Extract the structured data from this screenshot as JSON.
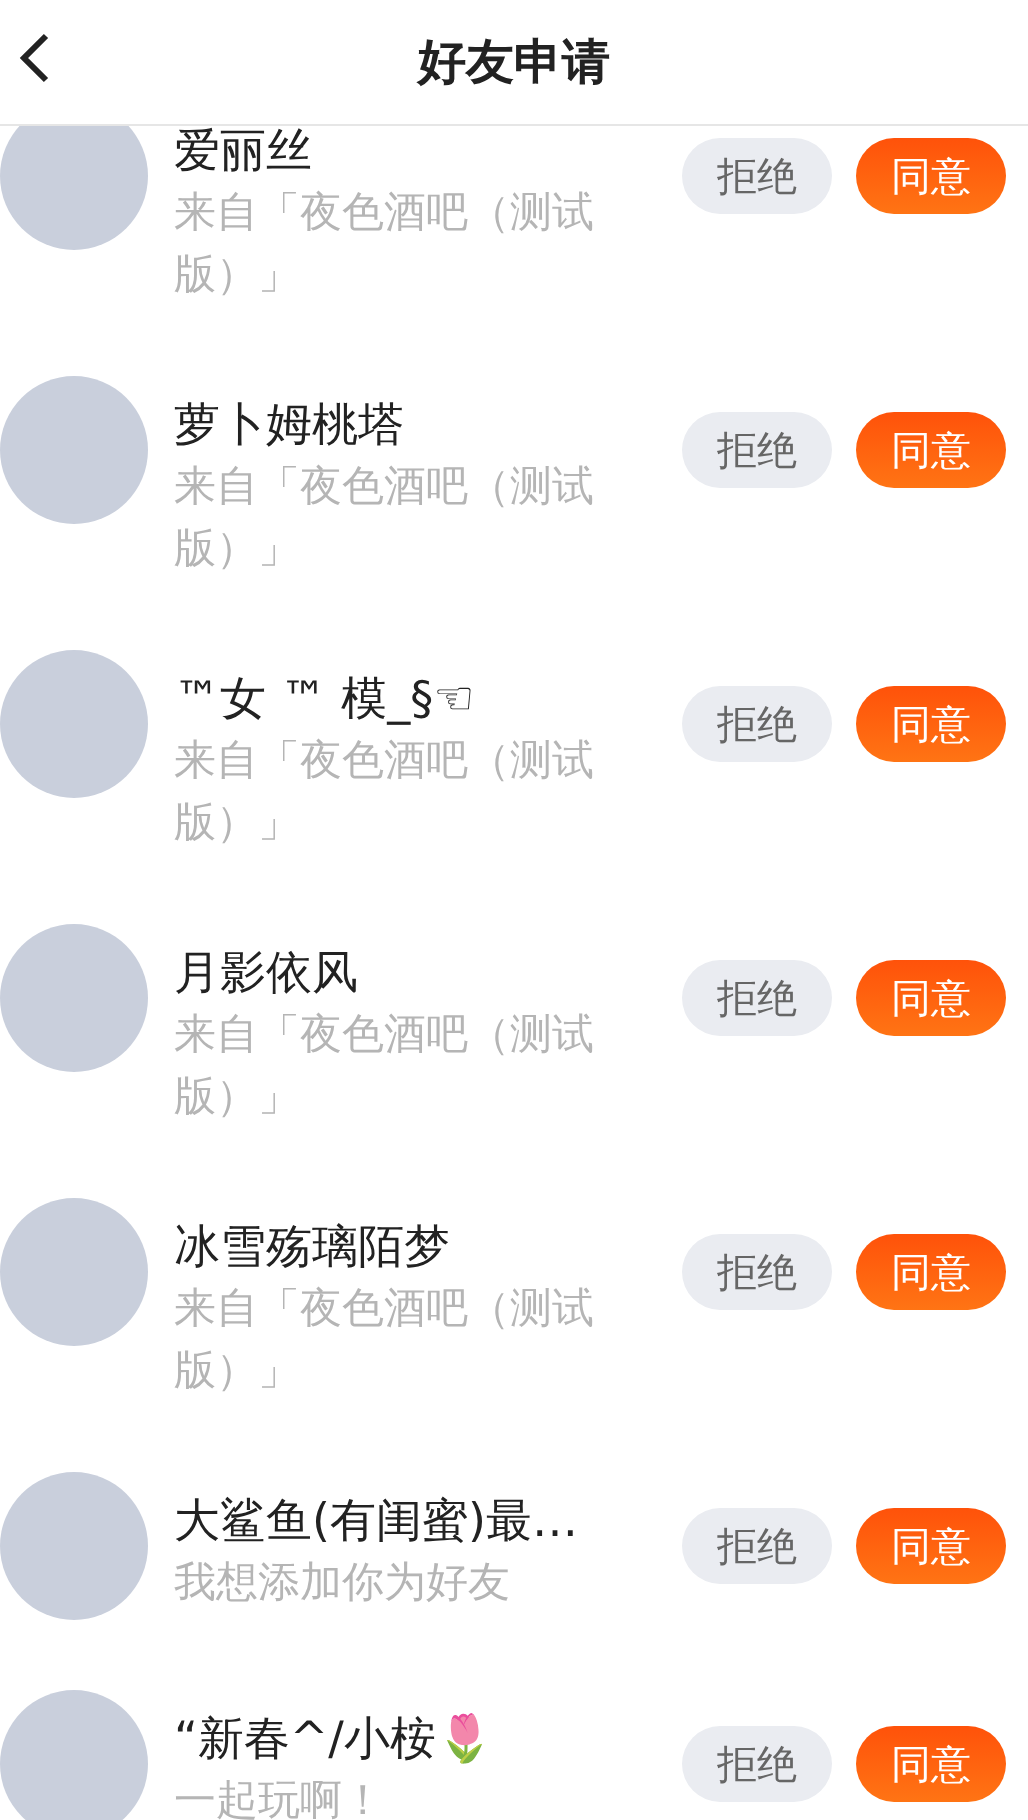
{
  "header": {
    "title": "好友申请"
  },
  "requests": [
    {
      "name": "爱丽丝",
      "message": "来自「夜色酒吧（测试版）」",
      "reject": "拒绝",
      "accept": "同意"
    },
    {
      "name": "萝卜姆桃塔",
      "message": "来自「夜色酒吧（测试版）」",
      "reject": "拒绝",
      "accept": "同意"
    },
    {
      "name": "™女 ™ 模_§☜",
      "message": "来自「夜色酒吧（测试版）」",
      "reject": "拒绝",
      "accept": "同意"
    },
    {
      "name": "月影依风",
      "message": "来自「夜色酒吧（测试版）」",
      "reject": "拒绝",
      "accept": "同意"
    },
    {
      "name": "冰雪殇璃陌梦",
      "message": "来自「夜色酒吧（测试版）」",
      "reject": "拒绝",
      "accept": "同意"
    },
    {
      "name": "大鲨鱼(有闺蜜)最…",
      "message": "我想添加你为好友",
      "reject": "拒绝",
      "accept": "同意"
    },
    {
      "name": "“新春^/小桉🌷",
      "message": "一起玩啊！",
      "reject": "拒绝",
      "accept": "同意"
    }
  ]
}
